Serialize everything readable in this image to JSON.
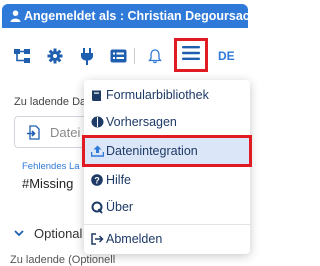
{
  "header": {
    "title": "Angemeldet als : Christian Degoursac"
  },
  "toolbar": {
    "icons": [
      "sitemap-icon",
      "gear-icon",
      "plug-icon",
      "list-icon",
      "bell-icon",
      "hamburger-menu-icon"
    ],
    "language": "DE"
  },
  "form": {
    "file_label": "Zu ladende Da",
    "file_placeholder": "Datei",
    "missing_label": "Fehlendes La",
    "missing_value": "#Missing",
    "optional_label": "Optional",
    "bottom_text": "Zu ladende (Optionell"
  },
  "menu": {
    "items": [
      {
        "label": "Formularbibliothek",
        "icon": "book-icon"
      },
      {
        "label": "Vorhersagen",
        "icon": "brain-icon"
      },
      {
        "label": "Datenintegration",
        "icon": "upload-icon"
      },
      {
        "label": "Hilfe",
        "icon": "question-icon"
      },
      {
        "label": "Über",
        "icon": "q-icon"
      },
      {
        "label": "Abmelden",
        "icon": "logout-icon"
      }
    ]
  },
  "colors": {
    "header_bg": "#2f79d8",
    "highlight": "#e01b24",
    "active_item": "#dbe7f8"
  }
}
